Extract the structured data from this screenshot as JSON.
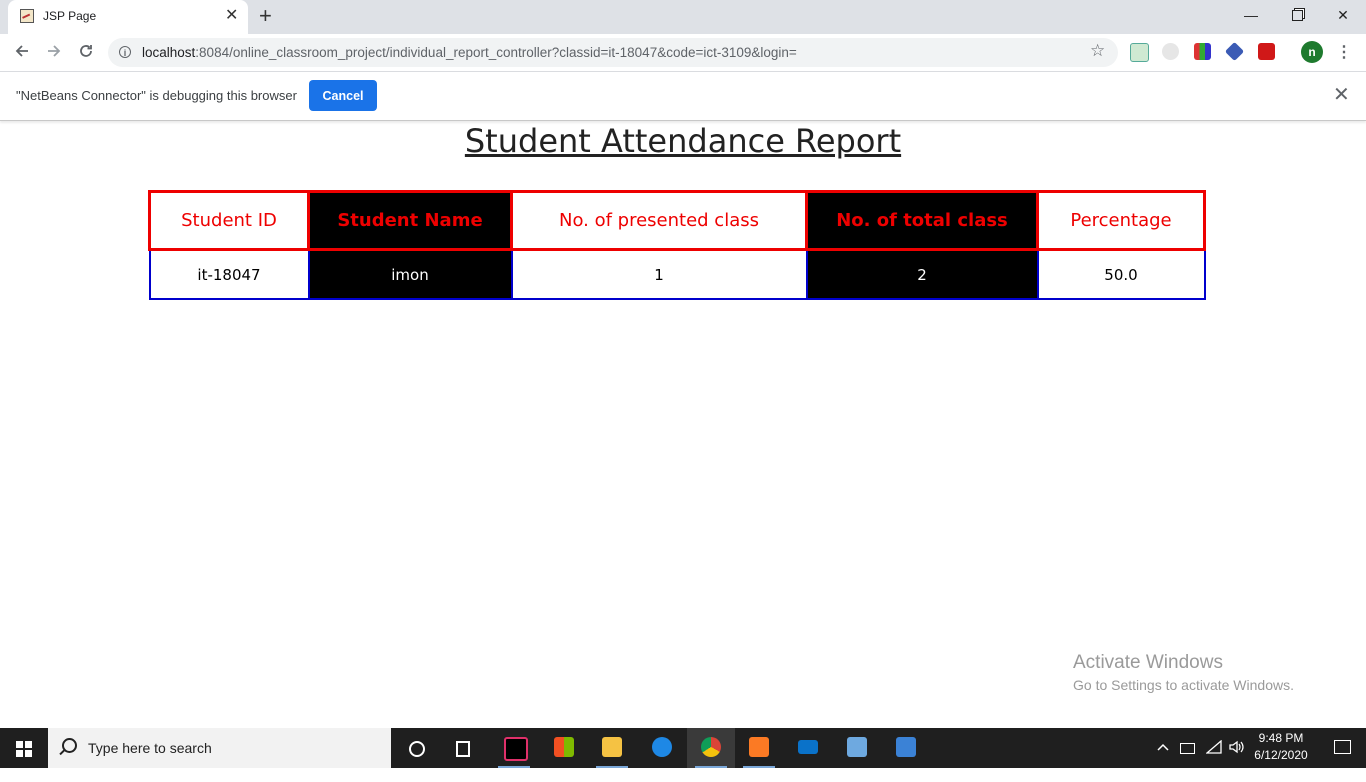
{
  "browser": {
    "tab_title": "JSP Page",
    "tab_close": "✕",
    "new_tab": "+",
    "url_host": "localhost",
    "url_rest": ":8084/online_classroom_project/individual_report_controller?classid=it-18047&code=ict-3109&login=",
    "profile_initial": "n",
    "window_controls": {
      "minimize": "—",
      "close": "✕"
    }
  },
  "infobar": {
    "message": "\"NetBeans Connector\" is debugging this browser",
    "cancel_label": "Cancel",
    "close": "✕"
  },
  "report": {
    "title": "Student Attendance Report",
    "headers": [
      "Student ID",
      "Student Name",
      "No. of presented class",
      "No. of total class",
      "Percentage"
    ],
    "rows": [
      [
        "it-18047",
        "imon",
        "1",
        "2",
        "50.0"
      ]
    ],
    "colors": {
      "header_text": "#ee0000",
      "header_border": "#ee0000",
      "cell_border": "#0000cc",
      "dark_column": "#000000"
    }
  },
  "watermark": {
    "title": "Activate Windows",
    "subtitle": "Go to Settings to activate Windows."
  },
  "taskbar": {
    "search_placeholder": "Type here to search",
    "apps": [
      "task-view",
      "intellij",
      "store",
      "file-explorer",
      "edge",
      "chrome",
      "xampp",
      "mail",
      "virtualbox",
      "photos"
    ],
    "time": "9:48 PM",
    "date": "6/12/2020"
  }
}
